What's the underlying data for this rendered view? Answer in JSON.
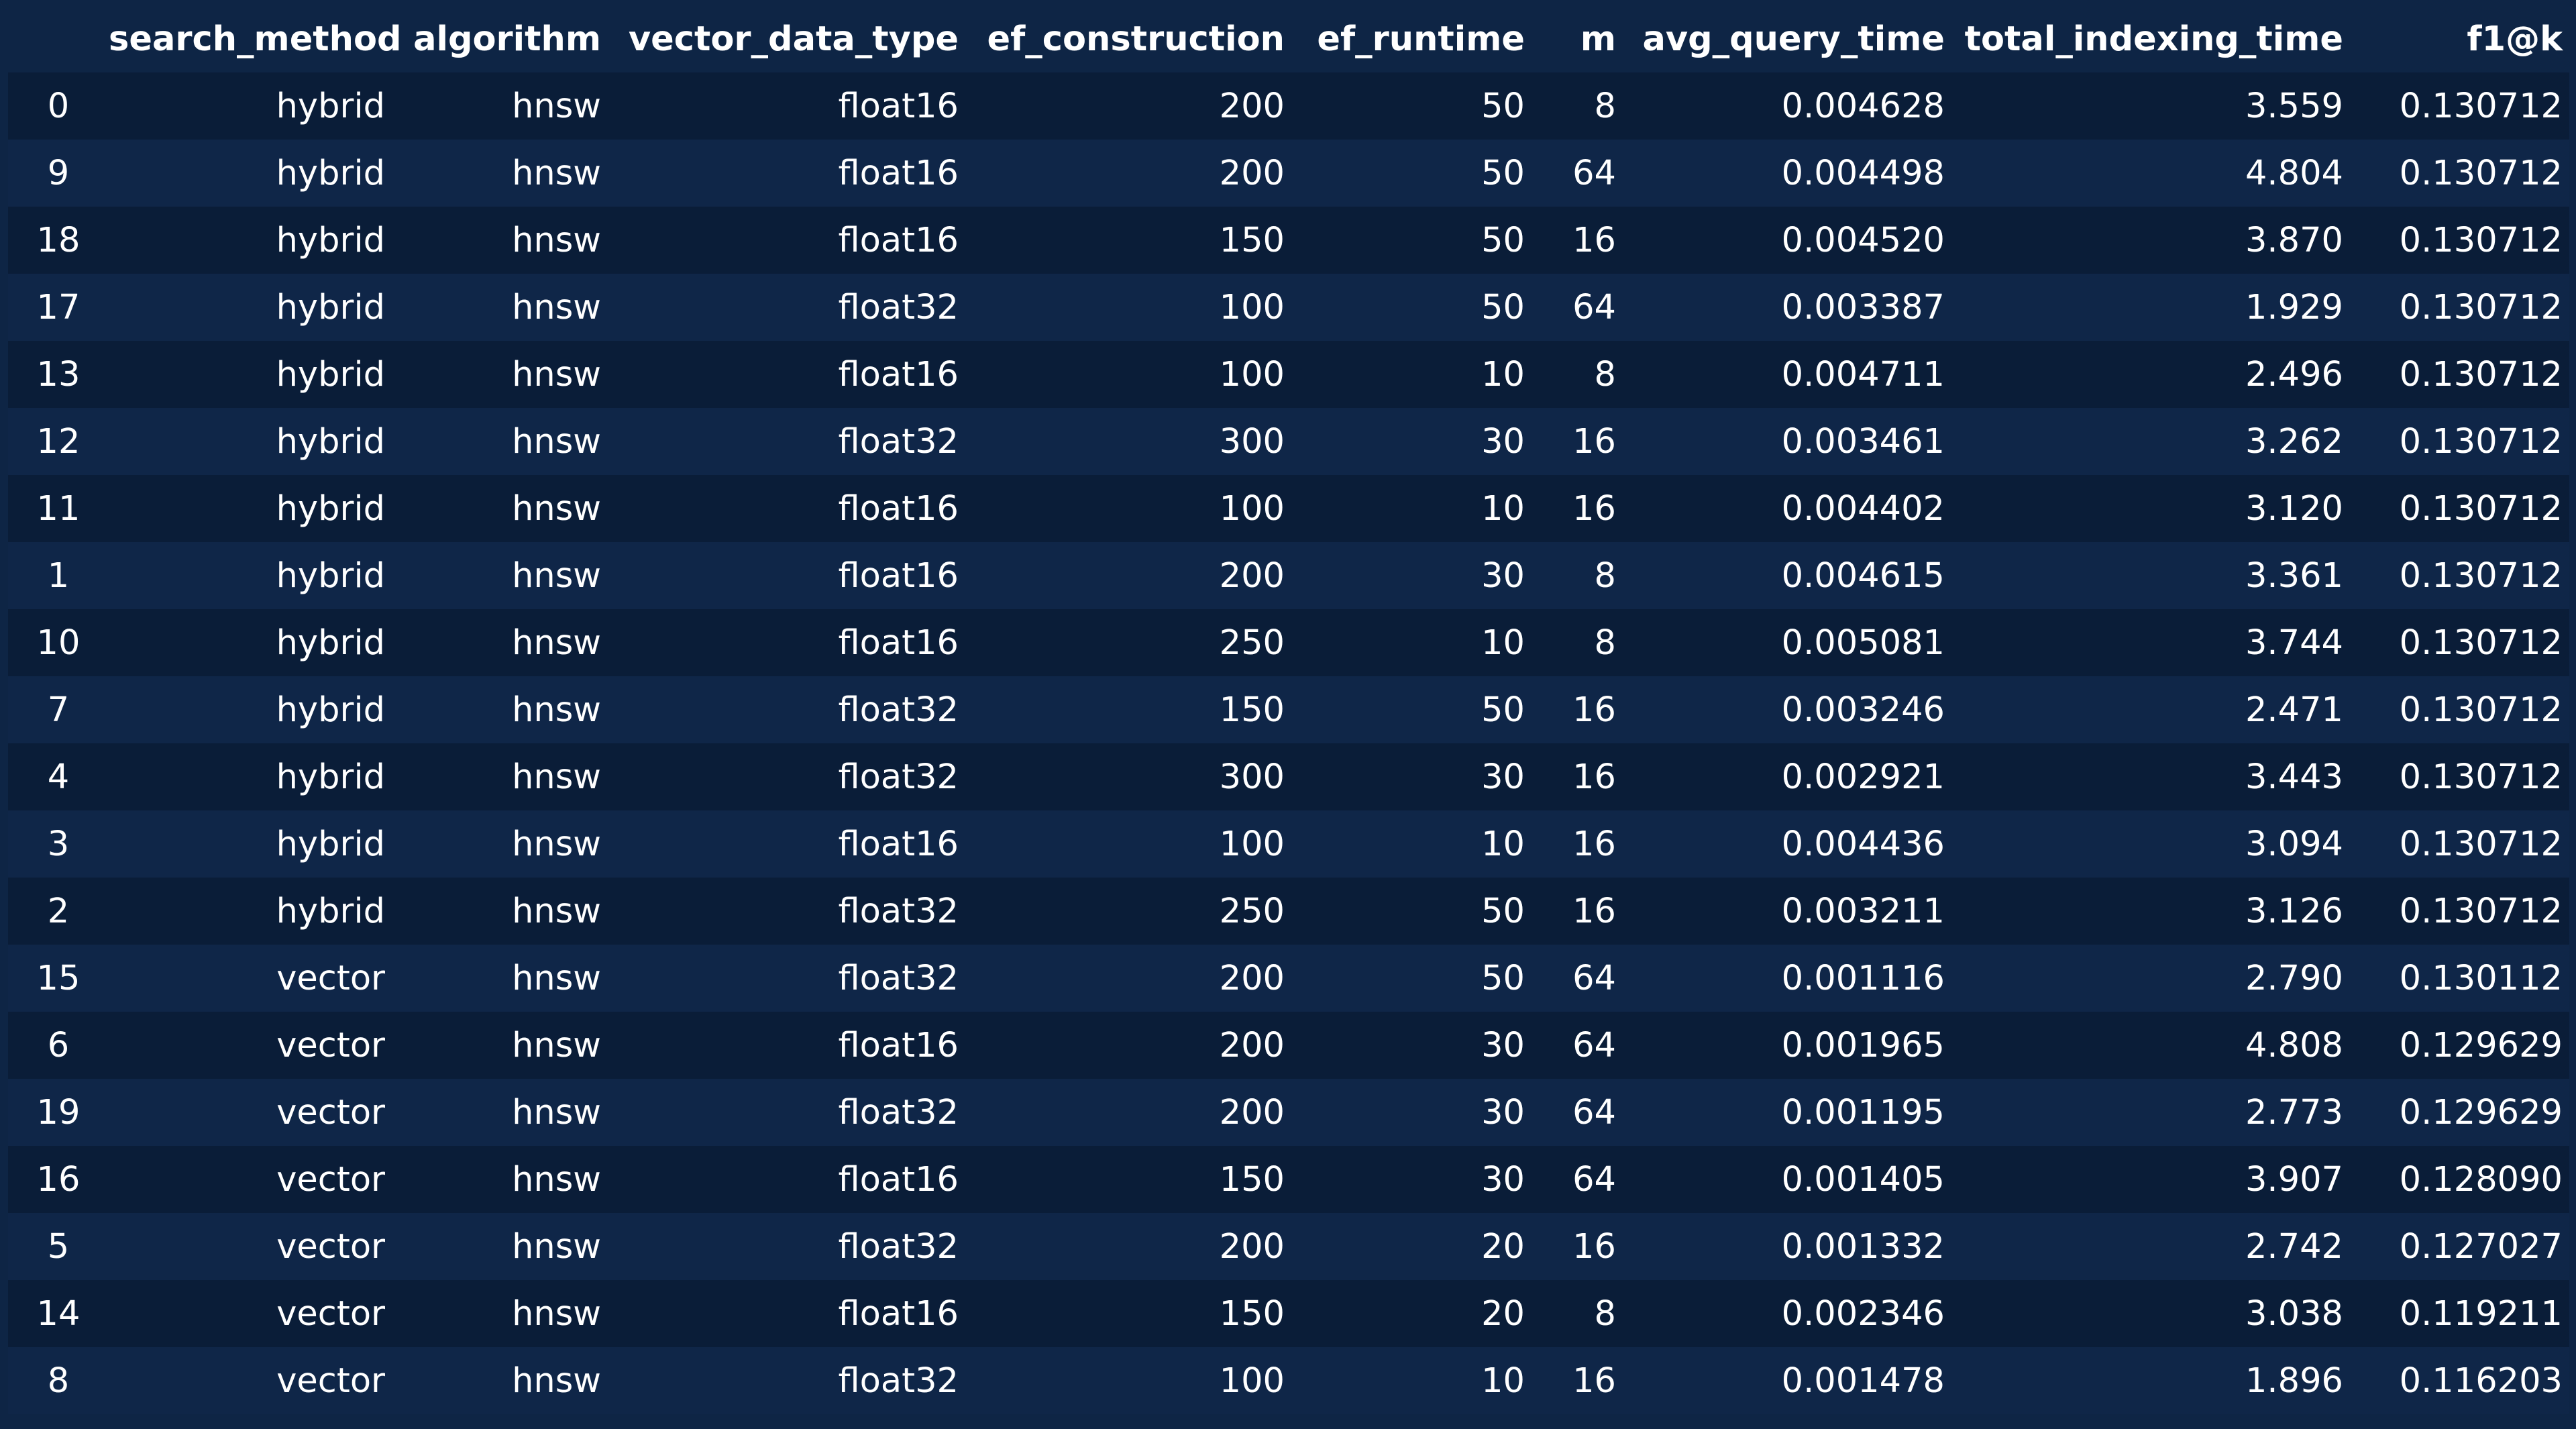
{
  "table": {
    "columns": [
      "",
      "search_method",
      "algorithm",
      "vector_data_type",
      "ef_construction",
      "ef_runtime",
      "m",
      "avg_query_time",
      "total_indexing_time",
      "f1@k"
    ],
    "rows": [
      [
        "0",
        "hybrid",
        "hnsw",
        "float16",
        "200",
        "50",
        "8",
        "0.004628",
        "3.559",
        "0.130712"
      ],
      [
        "9",
        "hybrid",
        "hnsw",
        "float16",
        "200",
        "50",
        "64",
        "0.004498",
        "4.804",
        "0.130712"
      ],
      [
        "18",
        "hybrid",
        "hnsw",
        "float16",
        "150",
        "50",
        "16",
        "0.004520",
        "3.870",
        "0.130712"
      ],
      [
        "17",
        "hybrid",
        "hnsw",
        "float32",
        "100",
        "50",
        "64",
        "0.003387",
        "1.929",
        "0.130712"
      ],
      [
        "13",
        "hybrid",
        "hnsw",
        "float16",
        "100",
        "10",
        "8",
        "0.004711",
        "2.496",
        "0.130712"
      ],
      [
        "12",
        "hybrid",
        "hnsw",
        "float32",
        "300",
        "30",
        "16",
        "0.003461",
        "3.262",
        "0.130712"
      ],
      [
        "11",
        "hybrid",
        "hnsw",
        "float16",
        "100",
        "10",
        "16",
        "0.004402",
        "3.120",
        "0.130712"
      ],
      [
        "1",
        "hybrid",
        "hnsw",
        "float16",
        "200",
        "30",
        "8",
        "0.004615",
        "3.361",
        "0.130712"
      ],
      [
        "10",
        "hybrid",
        "hnsw",
        "float16",
        "250",
        "10",
        "8",
        "0.005081",
        "3.744",
        "0.130712"
      ],
      [
        "7",
        "hybrid",
        "hnsw",
        "float32",
        "150",
        "50",
        "16",
        "0.003246",
        "2.471",
        "0.130712"
      ],
      [
        "4",
        "hybrid",
        "hnsw",
        "float32",
        "300",
        "30",
        "16",
        "0.002921",
        "3.443",
        "0.130712"
      ],
      [
        "3",
        "hybrid",
        "hnsw",
        "float16",
        "100",
        "10",
        "16",
        "0.004436",
        "3.094",
        "0.130712"
      ],
      [
        "2",
        "hybrid",
        "hnsw",
        "float32",
        "250",
        "50",
        "16",
        "0.003211",
        "3.126",
        "0.130712"
      ],
      [
        "15",
        "vector",
        "hnsw",
        "float32",
        "200",
        "50",
        "64",
        "0.001116",
        "2.790",
        "0.130112"
      ],
      [
        "6",
        "vector",
        "hnsw",
        "float16",
        "200",
        "30",
        "64",
        "0.001965",
        "4.808",
        "0.129629"
      ],
      [
        "19",
        "vector",
        "hnsw",
        "float32",
        "200",
        "30",
        "64",
        "0.001195",
        "2.773",
        "0.129629"
      ],
      [
        "16",
        "vector",
        "hnsw",
        "float16",
        "150",
        "30",
        "64",
        "0.001405",
        "3.907",
        "0.128090"
      ],
      [
        "5",
        "vector",
        "hnsw",
        "float32",
        "200",
        "20",
        "16",
        "0.001332",
        "2.742",
        "0.127027"
      ],
      [
        "14",
        "vector",
        "hnsw",
        "float16",
        "150",
        "20",
        "8",
        "0.002346",
        "3.038",
        "0.119211"
      ],
      [
        "8",
        "vector",
        "hnsw",
        "float32",
        "100",
        "10",
        "16",
        "0.001478",
        "1.896",
        "0.116203"
      ]
    ]
  },
  "colors": {
    "background": "#0e2545",
    "row_dark": "#0a1d38",
    "row_light": "#0f2648",
    "text": "#ffffff"
  }
}
